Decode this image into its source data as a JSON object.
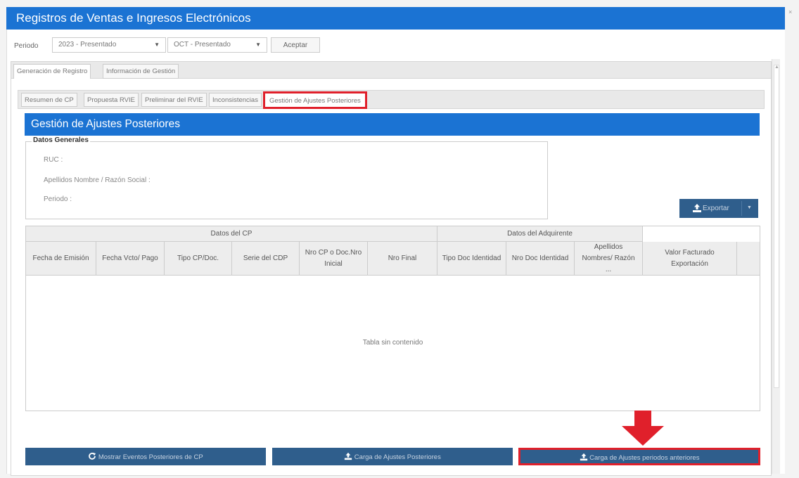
{
  "window": {
    "title": "Registros de Ventas e Ingresos Electrónicos",
    "close_glyph": "×"
  },
  "periodo": {
    "label": "Periodo",
    "year_select": "2023 - Presentado",
    "month_select": "OCT - Presentado",
    "accept": "Aceptar"
  },
  "outer_tabs": [
    "Generación de Registro",
    "Información de Gestión"
  ],
  "inner_tabs": [
    "Resumen de CP",
    "Propuesta RVIE",
    "Preliminar del RVIE",
    "Inconsistencias",
    "Gestión de Ajustes Posteriores"
  ],
  "section": {
    "title": "Gestión de Ajustes Posteriores"
  },
  "datos_generales": {
    "legend": "Datos Generales",
    "ruc": "RUC :",
    "nombre": "Apellidos Nombre / Razón Social :",
    "periodo": "Periodo :"
  },
  "export_button": "Exportar",
  "table": {
    "groups": [
      "Datos del CP",
      "Datos del Adquirente"
    ],
    "columns": [
      "Fecha de Emisión",
      "Fecha Vcto/ Pago",
      "Tipo CP/Doc.",
      "Serie del CDP",
      "Nro CP o Doc.Nro Inicial",
      "Nro Final",
      "Tipo Doc Identidad",
      "Nro Doc Identidad",
      "Apellidos Nombres/ Razón ...",
      "Valor Facturado Exportación"
    ],
    "empty_message": "Tabla sin contenido"
  },
  "bottom_buttons": {
    "mostrar": "Mostrar Eventos Posteriores de CP",
    "carga": "Carga de Ajustes Posteriores",
    "carga_anteriores": "Carga de Ajustes periodos anteriores"
  },
  "colors": {
    "primary": "#1b73d3",
    "button": "#2f5e8c",
    "highlight": "#e0202b"
  },
  "icons": {
    "refresh": "refresh-icon",
    "upload": "upload-icon",
    "arrow": "down-arrow-icon"
  }
}
